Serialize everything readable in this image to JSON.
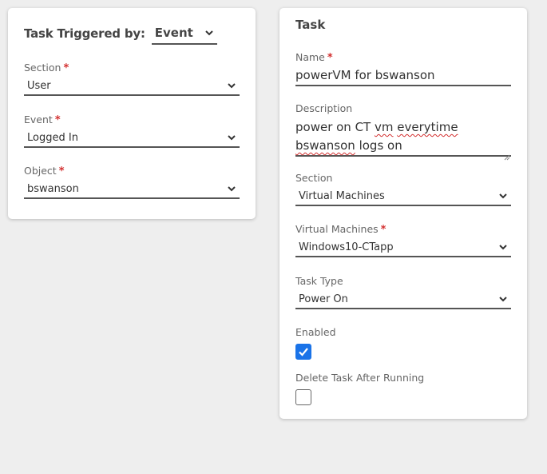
{
  "trigger": {
    "label": "Task Triggered by:",
    "value": "Event"
  },
  "left": {
    "section": {
      "label": "Section",
      "value": "User"
    },
    "event": {
      "label": "Event",
      "value": "Logged In"
    },
    "object": {
      "label": "Object",
      "value": "bswanson"
    },
    "required_mark": "*"
  },
  "task": {
    "title": "Task",
    "name": {
      "label": "Name",
      "value": "powerVM for bswanson"
    },
    "description": {
      "label": "Description",
      "line1_a": "power on CT ",
      "line1_b": "vm",
      "line1_c": " ",
      "line1_d": "everytime",
      "line2_a": "bswanson",
      "line2_b": " logs on"
    },
    "section": {
      "label": "Section",
      "value": "Virtual Machines"
    },
    "virtual_machines": {
      "label": "Virtual Machines",
      "value": "Windows10-CTapp"
    },
    "task_type": {
      "label": "Task Type",
      "value": "Power On"
    },
    "enabled": {
      "label": "Enabled",
      "checked": true
    },
    "delete_after": {
      "label": "Delete Task After Running",
      "checked": false
    }
  },
  "colors": {
    "accent": "#1a73e8",
    "required": "#d32f2f",
    "background": "#eeeeee"
  }
}
